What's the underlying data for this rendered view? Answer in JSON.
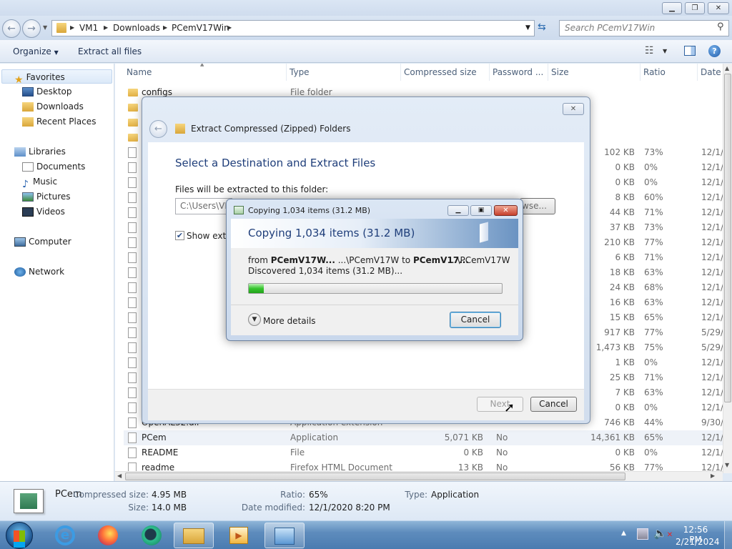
{
  "window": {
    "min": "▁",
    "max": "❐",
    "close": "✕"
  },
  "address": {
    "crumbs": [
      "VM1",
      "Downloads",
      "PCemV17Win"
    ],
    "search_placeholder": "Search PCemV17Win"
  },
  "toolbar": {
    "organize": "Organize",
    "extract_all": "Extract all files"
  },
  "nav": {
    "favorites": "Favorites",
    "fav_items": [
      "Desktop",
      "Downloads",
      "Recent Places"
    ],
    "libraries": "Libraries",
    "lib_items": [
      "Documents",
      "Music",
      "Pictures",
      "Videos"
    ],
    "computer": "Computer",
    "network": "Network"
  },
  "columns": [
    "Name",
    "Type",
    "Compressed size",
    "Password ...",
    "Size",
    "Ratio",
    "Date"
  ],
  "files": [
    {
      "name": "configs",
      "type": "File folder",
      "comp": "",
      "pw": "",
      "size": "",
      "ratio": "",
      "date": ""
    },
    {
      "name": "",
      "type": "",
      "comp": "",
      "pw": "",
      "size": "",
      "ratio": "",
      "date": ""
    },
    {
      "name": "",
      "type": "",
      "comp": "",
      "pw": "",
      "size": "",
      "ratio": "",
      "date": ""
    },
    {
      "name": "",
      "type": "",
      "comp": "",
      "pw": "",
      "size": "",
      "ratio": "",
      "date": ""
    },
    {
      "name": "",
      "type": "",
      "comp": "",
      "pw": "",
      "size": "102 KB",
      "ratio": "73%",
      "date": "12/1/"
    },
    {
      "name": "",
      "type": "",
      "comp": "",
      "pw": "",
      "size": "0 KB",
      "ratio": "0%",
      "date": "12/1/"
    },
    {
      "name": "",
      "type": "",
      "comp": "",
      "pw": "",
      "size": "0 KB",
      "ratio": "0%",
      "date": "12/1/"
    },
    {
      "name": "",
      "type": "",
      "comp": "",
      "pw": "",
      "size": "8 KB",
      "ratio": "60%",
      "date": "12/1/"
    },
    {
      "name": "",
      "type": "",
      "comp": "",
      "pw": "",
      "size": "44 KB",
      "ratio": "71%",
      "date": "12/1/"
    },
    {
      "name": "",
      "type": "",
      "comp": "",
      "pw": "",
      "size": "37 KB",
      "ratio": "73%",
      "date": "12/1/"
    },
    {
      "name": "",
      "type": "",
      "comp": "",
      "pw": "",
      "size": "210 KB",
      "ratio": "77%",
      "date": "12/1/"
    },
    {
      "name": "",
      "type": "",
      "comp": "",
      "pw": "",
      "size": "6 KB",
      "ratio": "71%",
      "date": "12/1/"
    },
    {
      "name": "",
      "type": "",
      "comp": "",
      "pw": "",
      "size": "18 KB",
      "ratio": "63%",
      "date": "12/1/"
    },
    {
      "name": "",
      "type": "",
      "comp": "",
      "pw": "",
      "size": "24 KB",
      "ratio": "68%",
      "date": "12/1/"
    },
    {
      "name": "",
      "type": "",
      "comp": "",
      "pw": "",
      "size": "16 KB",
      "ratio": "63%",
      "date": "12/1/"
    },
    {
      "name": "",
      "type": "",
      "comp": "",
      "pw": "",
      "size": "15 KB",
      "ratio": "65%",
      "date": "12/1/"
    },
    {
      "name": "",
      "type": "",
      "comp": "",
      "pw": "",
      "size": "917 KB",
      "ratio": "77%",
      "date": "5/29/"
    },
    {
      "name": "",
      "type": "",
      "comp": "",
      "pw": "",
      "size": "1,473 KB",
      "ratio": "75%",
      "date": "5/29/"
    },
    {
      "name": "",
      "type": "",
      "comp": "",
      "pw": "",
      "size": "1 KB",
      "ratio": "0%",
      "date": "12/1/"
    },
    {
      "name": "",
      "type": "",
      "comp": "",
      "pw": "",
      "size": "25 KB",
      "ratio": "71%",
      "date": "12/1/"
    },
    {
      "name": "",
      "type": "",
      "comp": "",
      "pw": "",
      "size": "7 KB",
      "ratio": "63%",
      "date": "12/1/"
    },
    {
      "name": "",
      "type": "",
      "comp": "",
      "pw": "",
      "size": "0 KB",
      "ratio": "0%",
      "date": "12/1/"
    },
    {
      "name": "OpenAL32.dll",
      "type": "Application extension",
      "comp": "",
      "pw": "",
      "size": "746 KB",
      "ratio": "44%",
      "date": "9/30/"
    },
    {
      "name": "PCem",
      "type": "Application",
      "comp": "5,071 KB",
      "pw": "No",
      "size": "14,361 KB",
      "ratio": "65%",
      "date": "12/1/"
    },
    {
      "name": "README",
      "type": "File",
      "comp": "0 KB",
      "pw": "No",
      "size": "0 KB",
      "ratio": "0%",
      "date": "12/1/"
    },
    {
      "name": "readme",
      "type": "Firefox HTML Document",
      "comp": "13 KB",
      "pw": "No",
      "size": "56 KB",
      "ratio": "77%",
      "date": "12/1/"
    }
  ],
  "details": {
    "name": "PCem",
    "comp_label": "Compressed size:",
    "comp_value": "4.95 MB",
    "size_label": "Size:",
    "size_value": "14.0 MB",
    "ratio_label": "Ratio:",
    "ratio_value": "65%",
    "date_label": "Date modified:",
    "date_value": "12/1/2020 8:20 PM",
    "type_label": "Type:",
    "type_value": "Application"
  },
  "wizard": {
    "title": "Extract Compressed (Zipped) Folders",
    "heading": "Select a Destination and Extract Files",
    "label": "Files will be extracted to this folder:",
    "path": "C:\\Users\\VM",
    "browse": "wse...",
    "checkbox": "Show extra",
    "next": "Next",
    "cancel": "Cancel",
    "close": "✕"
  },
  "copy": {
    "title": "Copying 1,034 items (31.2 MB)",
    "heading": "Copying 1,034 items (31.2 MB)",
    "from_prefix": "from ",
    "from_src": "PCemV17W...",
    "from_mid": " ...\\PCemV17W to ",
    "to_dst": "PCemV17...",
    "to_path": "...\\PCemV17W",
    "discovered": "Discovered 1,034 items (31.2 MB)...",
    "progress": 0.06,
    "more": "More details",
    "cancel": "Cancel"
  },
  "clock": {
    "time": "12:56 PM",
    "date": "2/21/2024"
  }
}
